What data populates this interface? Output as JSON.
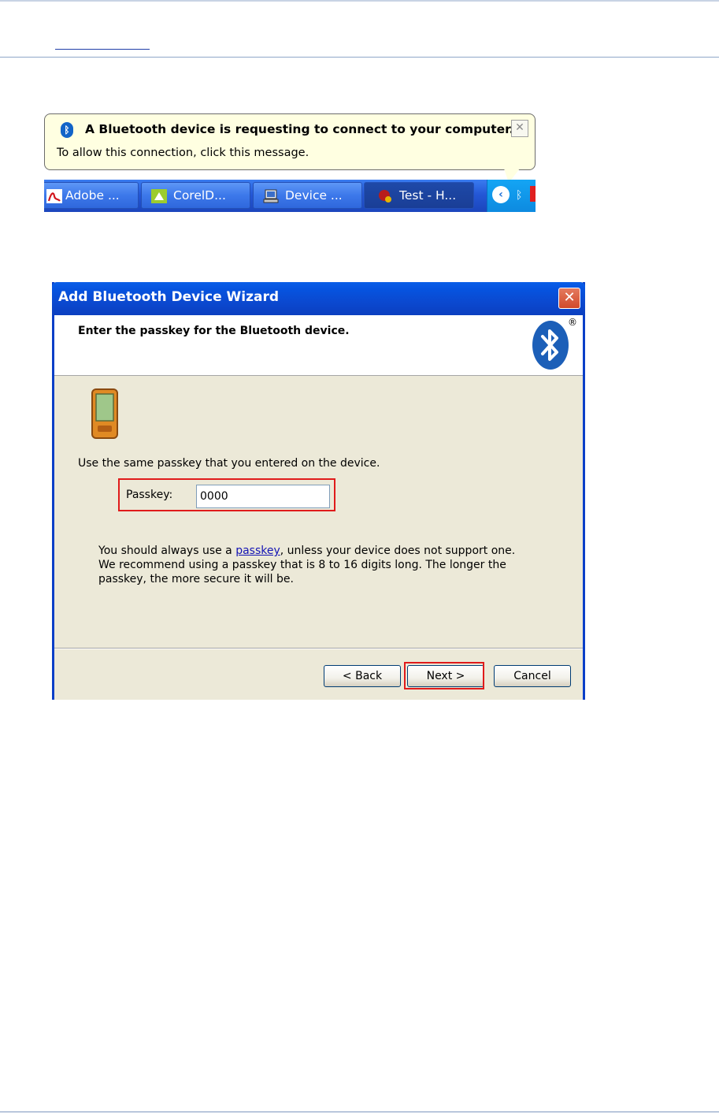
{
  "balloon": {
    "title": "A Bluetooth device is requesting to connect to your computer.",
    "message": "To allow this connection, click this message.",
    "close_glyph": "✕",
    "icon": "bluetooth-icon"
  },
  "taskbar": {
    "buttons": [
      {
        "label": "Adobe ...",
        "icon": "acrobat-icon"
      },
      {
        "label": "CorelD...",
        "icon": "coreldraw-icon"
      },
      {
        "label": "Device ...",
        "icon": "device-manager-icon"
      },
      {
        "label": "Test - H...",
        "icon": "app-icon"
      }
    ],
    "tray_chevron": "‹"
  },
  "wizard": {
    "title": "Add Bluetooth Device Wizard",
    "heading": "Enter the passkey for the Bluetooth device.",
    "registered_mark": "®",
    "instruction": "Use the same passkey that you entered on the device.",
    "passkey_label": "Passkey:",
    "passkey_value": "0000",
    "info_prefix": "You should always use a ",
    "info_link": "passkey",
    "info_suffix": ", unless your device does not support one. We recommend using a passkey that is 8 to 16 digits long. The longer the passkey, the more secure it will be.",
    "back_label": "< Back",
    "next_label": "Next >",
    "cancel_label": "Cancel",
    "close_glyph": "✕"
  },
  "colors": {
    "highlight": "#e01b1b",
    "xp_title_blue": "#0b49d0",
    "dialog_face": "#ece9d8",
    "balloon_bg": "#ffffe1"
  }
}
